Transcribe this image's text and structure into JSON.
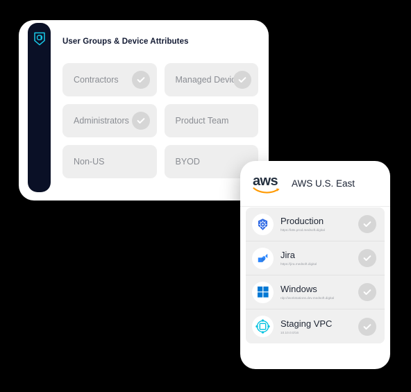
{
  "groups_card": {
    "title": "User Groups & Device Attributes",
    "brand_icon": "shield-logo-icon",
    "chips": [
      {
        "label": "Contractors",
        "checked": true,
        "icon": "check-circle-icon"
      },
      {
        "label": "Managed Device",
        "checked": true,
        "icon": "check-circle-icon"
      },
      {
        "label": "Administrators",
        "checked": true,
        "icon": "check-circle-icon"
      },
      {
        "label": "Product Team",
        "checked": false,
        "icon": ""
      },
      {
        "label": "Non-US",
        "checked": false,
        "icon": ""
      },
      {
        "label": "BYOD",
        "checked": false,
        "icon": ""
      }
    ]
  },
  "aws_card": {
    "logo_text": "aws",
    "logo_icon": "aws-smile-arrow-icon",
    "region_title": "AWS U.S. East",
    "resources": [
      {
        "name": "Production",
        "url": "https://k8s.prod.medsoft.digital",
        "icon": "kubernetes-icon",
        "checked": true
      },
      {
        "name": "Jira",
        "url": "https://jira.medsoft.digital",
        "icon": "jira-icon",
        "checked": true
      },
      {
        "name": "Windows",
        "url": "rdp://workstations.dev.medsoft.digital",
        "icon": "windows-icon",
        "checked": true
      },
      {
        "name": "Staging VPC",
        "url": "10.10.0.0/16",
        "icon": "vpc-network-icon",
        "checked": true
      }
    ]
  },
  "colors": {
    "background": "#000000",
    "card_surface": "#ffffff",
    "sidebar_dark": "#0a1026",
    "brand_cyan": "#18c8e8",
    "chip_surface": "#eeeeee",
    "chip_label": "#8a8d93",
    "check_circle": "#d6d6d6",
    "check_mark": "#ffffff",
    "aws_logo_dark": "#232f3e",
    "aws_smile_orange": "#ff9900",
    "kubernetes_blue": "#326ce5",
    "jira_blue": "#2684ff",
    "windows_blue": "#0078d4",
    "vpc_cyan": "#00c2e0",
    "heading_text": "#121a33",
    "row_surface": "#f0f0f0"
  }
}
